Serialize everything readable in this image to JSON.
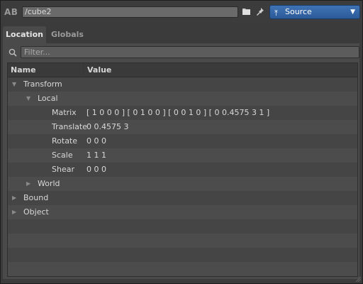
{
  "toolbar": {
    "app_label": "AB",
    "path": "/cube2",
    "source_label": "Source",
    "source_icon": "⤒",
    "dropdown_arrow": "▼"
  },
  "tabs": [
    {
      "label": "Location",
      "active": true
    },
    {
      "label": "Globals",
      "active": false
    }
  ],
  "filter": {
    "placeholder": "Filter..."
  },
  "table": {
    "columns": [
      "Name",
      "Value"
    ],
    "rows": [
      {
        "name": "Transform",
        "value": "",
        "expander": "▼"
      },
      {
        "name": "Local",
        "value": "",
        "expander": "▼"
      },
      {
        "name": "Matrix",
        "value": "[ 1 0 0 0 ] [ 0 1 0 0 ] [ 0 0 1 0 ] [ 0 0.4575 3 1 ]",
        "expander": ""
      },
      {
        "name": "Translate",
        "value": "0 0.4575 3",
        "expander": ""
      },
      {
        "name": "Rotate",
        "value": "0 0 0",
        "expander": ""
      },
      {
        "name": "Scale",
        "value": "1 1 1",
        "expander": ""
      },
      {
        "name": "Shear",
        "value": "0 0 0",
        "expander": ""
      },
      {
        "name": "World",
        "value": "",
        "expander": "▶"
      },
      {
        "name": "Bound",
        "value": "",
        "expander": "▶"
      },
      {
        "name": "Object",
        "value": "",
        "expander": "▶"
      }
    ]
  },
  "colors": {
    "accent": "#3a6db0",
    "background": "#3b3b3b",
    "panel": "#4a4a4a"
  }
}
